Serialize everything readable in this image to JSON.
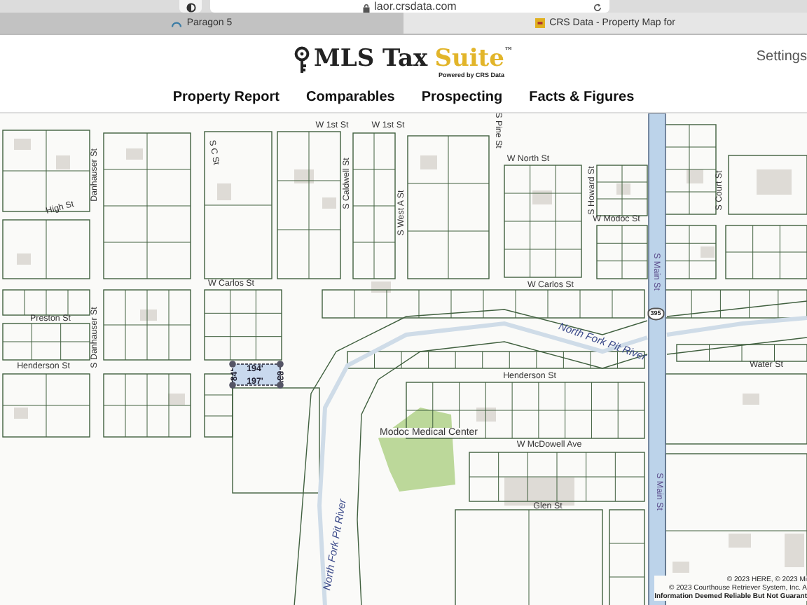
{
  "browser": {
    "address": "laor.crsdata.com",
    "tabs": [
      {
        "label": "Paragon 5",
        "selected": false
      },
      {
        "label": "CRS Data - Property Map for",
        "selected": true
      }
    ]
  },
  "header": {
    "logo": {
      "name": "MLS Tax",
      "accent": "Suite",
      "trademark": "™",
      "tagline": "Powered by CRS Data"
    },
    "settings": "Settings"
  },
  "nav": [
    {
      "label": "Property Report"
    },
    {
      "label": "Comparables"
    },
    {
      "label": "Prospecting"
    },
    {
      "label": "Facts & Figures"
    }
  ],
  "map": {
    "labels": [
      {
        "kind": "street",
        "text": "W 1st St"
      },
      {
        "kind": "street",
        "text": "W 1st St"
      },
      {
        "kind": "street",
        "text": "S C St"
      },
      {
        "kind": "street",
        "text": "Danhauser St"
      },
      {
        "kind": "street",
        "text": "S Caldwell St"
      },
      {
        "kind": "street",
        "text": "High St"
      },
      {
        "kind": "street",
        "text": "S West A St"
      },
      {
        "kind": "street",
        "text": "S Pine St"
      },
      {
        "kind": "street",
        "text": "W North St"
      },
      {
        "kind": "street",
        "text": "S Howard St"
      },
      {
        "kind": "street",
        "text": "W Modoc St"
      },
      {
        "kind": "street",
        "text": "S Court St"
      },
      {
        "kind": "street",
        "text": "W Carlos St"
      },
      {
        "kind": "street",
        "text": "W Carlos St"
      },
      {
        "kind": "highway",
        "text": "S Main St"
      },
      {
        "kind": "shield",
        "text": "395"
      },
      {
        "kind": "street",
        "text": "Preston St"
      },
      {
        "kind": "street",
        "text": "S Danhauser St"
      },
      {
        "kind": "street",
        "text": "Henderson St"
      },
      {
        "kind": "street",
        "text": "Henderson St"
      },
      {
        "kind": "river",
        "text": "North Fork Pit River"
      },
      {
        "kind": "street",
        "text": "Water St"
      },
      {
        "kind": "place",
        "text": "Modoc Medical Center"
      },
      {
        "kind": "street",
        "text": "W McDowell Ave"
      },
      {
        "kind": "highway",
        "text": "S Main St"
      },
      {
        "kind": "street",
        "text": "Glen St"
      },
      {
        "kind": "river",
        "text": "North Fork Pit River"
      },
      {
        "kind": "measure",
        "text": "194'"
      },
      {
        "kind": "measure",
        "text": "197'"
      },
      {
        "kind": "measure",
        "text": "83'"
      },
      {
        "kind": "measure",
        "text": "84'"
      }
    ],
    "attribution": [
      "© 2023 HERE, © 2023 Mi",
      "© 2023 Courthouse Retriever System, Inc. A",
      "Information Deemed Reliable But Not Guarant"
    ]
  }
}
